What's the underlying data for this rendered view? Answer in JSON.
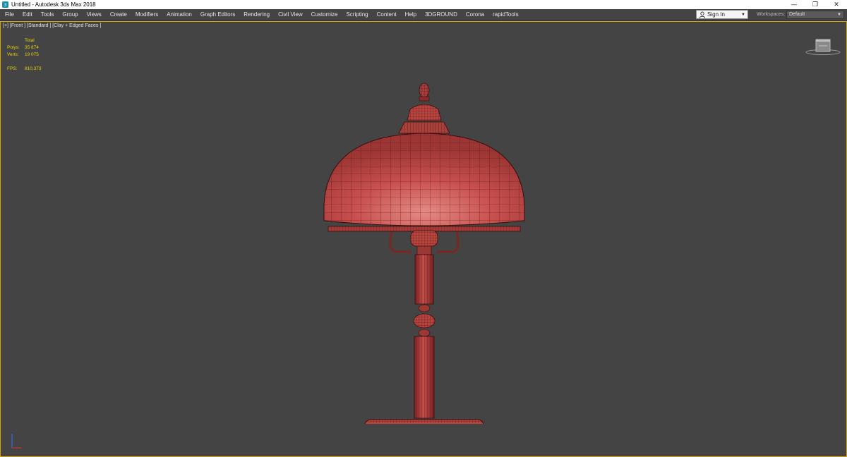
{
  "window": {
    "title": "Untitled - Autodesk 3ds Max 2018",
    "controls": {
      "minimize": "—",
      "restore": "❐",
      "close": "✕"
    }
  },
  "menu": [
    "File",
    "Edit",
    "Tools",
    "Group",
    "Views",
    "Create",
    "Modifiers",
    "Animation",
    "Graph Editors",
    "Rendering",
    "Civil View",
    "Customize",
    "Scripting",
    "Content",
    "Help",
    "3DGROUND",
    "Corona",
    "rapidTools"
  ],
  "account": {
    "signin_label": "Sign In"
  },
  "workspace": {
    "label": "Workspaces:",
    "value": "Default"
  },
  "viewport": {
    "label": "[+] [Front ] [Standard ] [Clay + Edged Faces ]",
    "stats": {
      "header": "Total",
      "polys_label": "Polys:",
      "polys_value": "35 874",
      "verts_label": "Verts:",
      "verts_value": "19 075",
      "fps_label": "FPS:",
      "fps_value": "810,373"
    }
  },
  "colors": {
    "viewport_bg": "#444444",
    "active_border": "#d9a400",
    "stats_text": "#e8d600",
    "model_clay": "#c8504e",
    "model_wire": "#5a1414"
  },
  "icons": {
    "app": "3dsmax-icon",
    "user": "user-icon",
    "viewcube": "viewcube-icon",
    "axis": "axis-tripod-icon"
  }
}
